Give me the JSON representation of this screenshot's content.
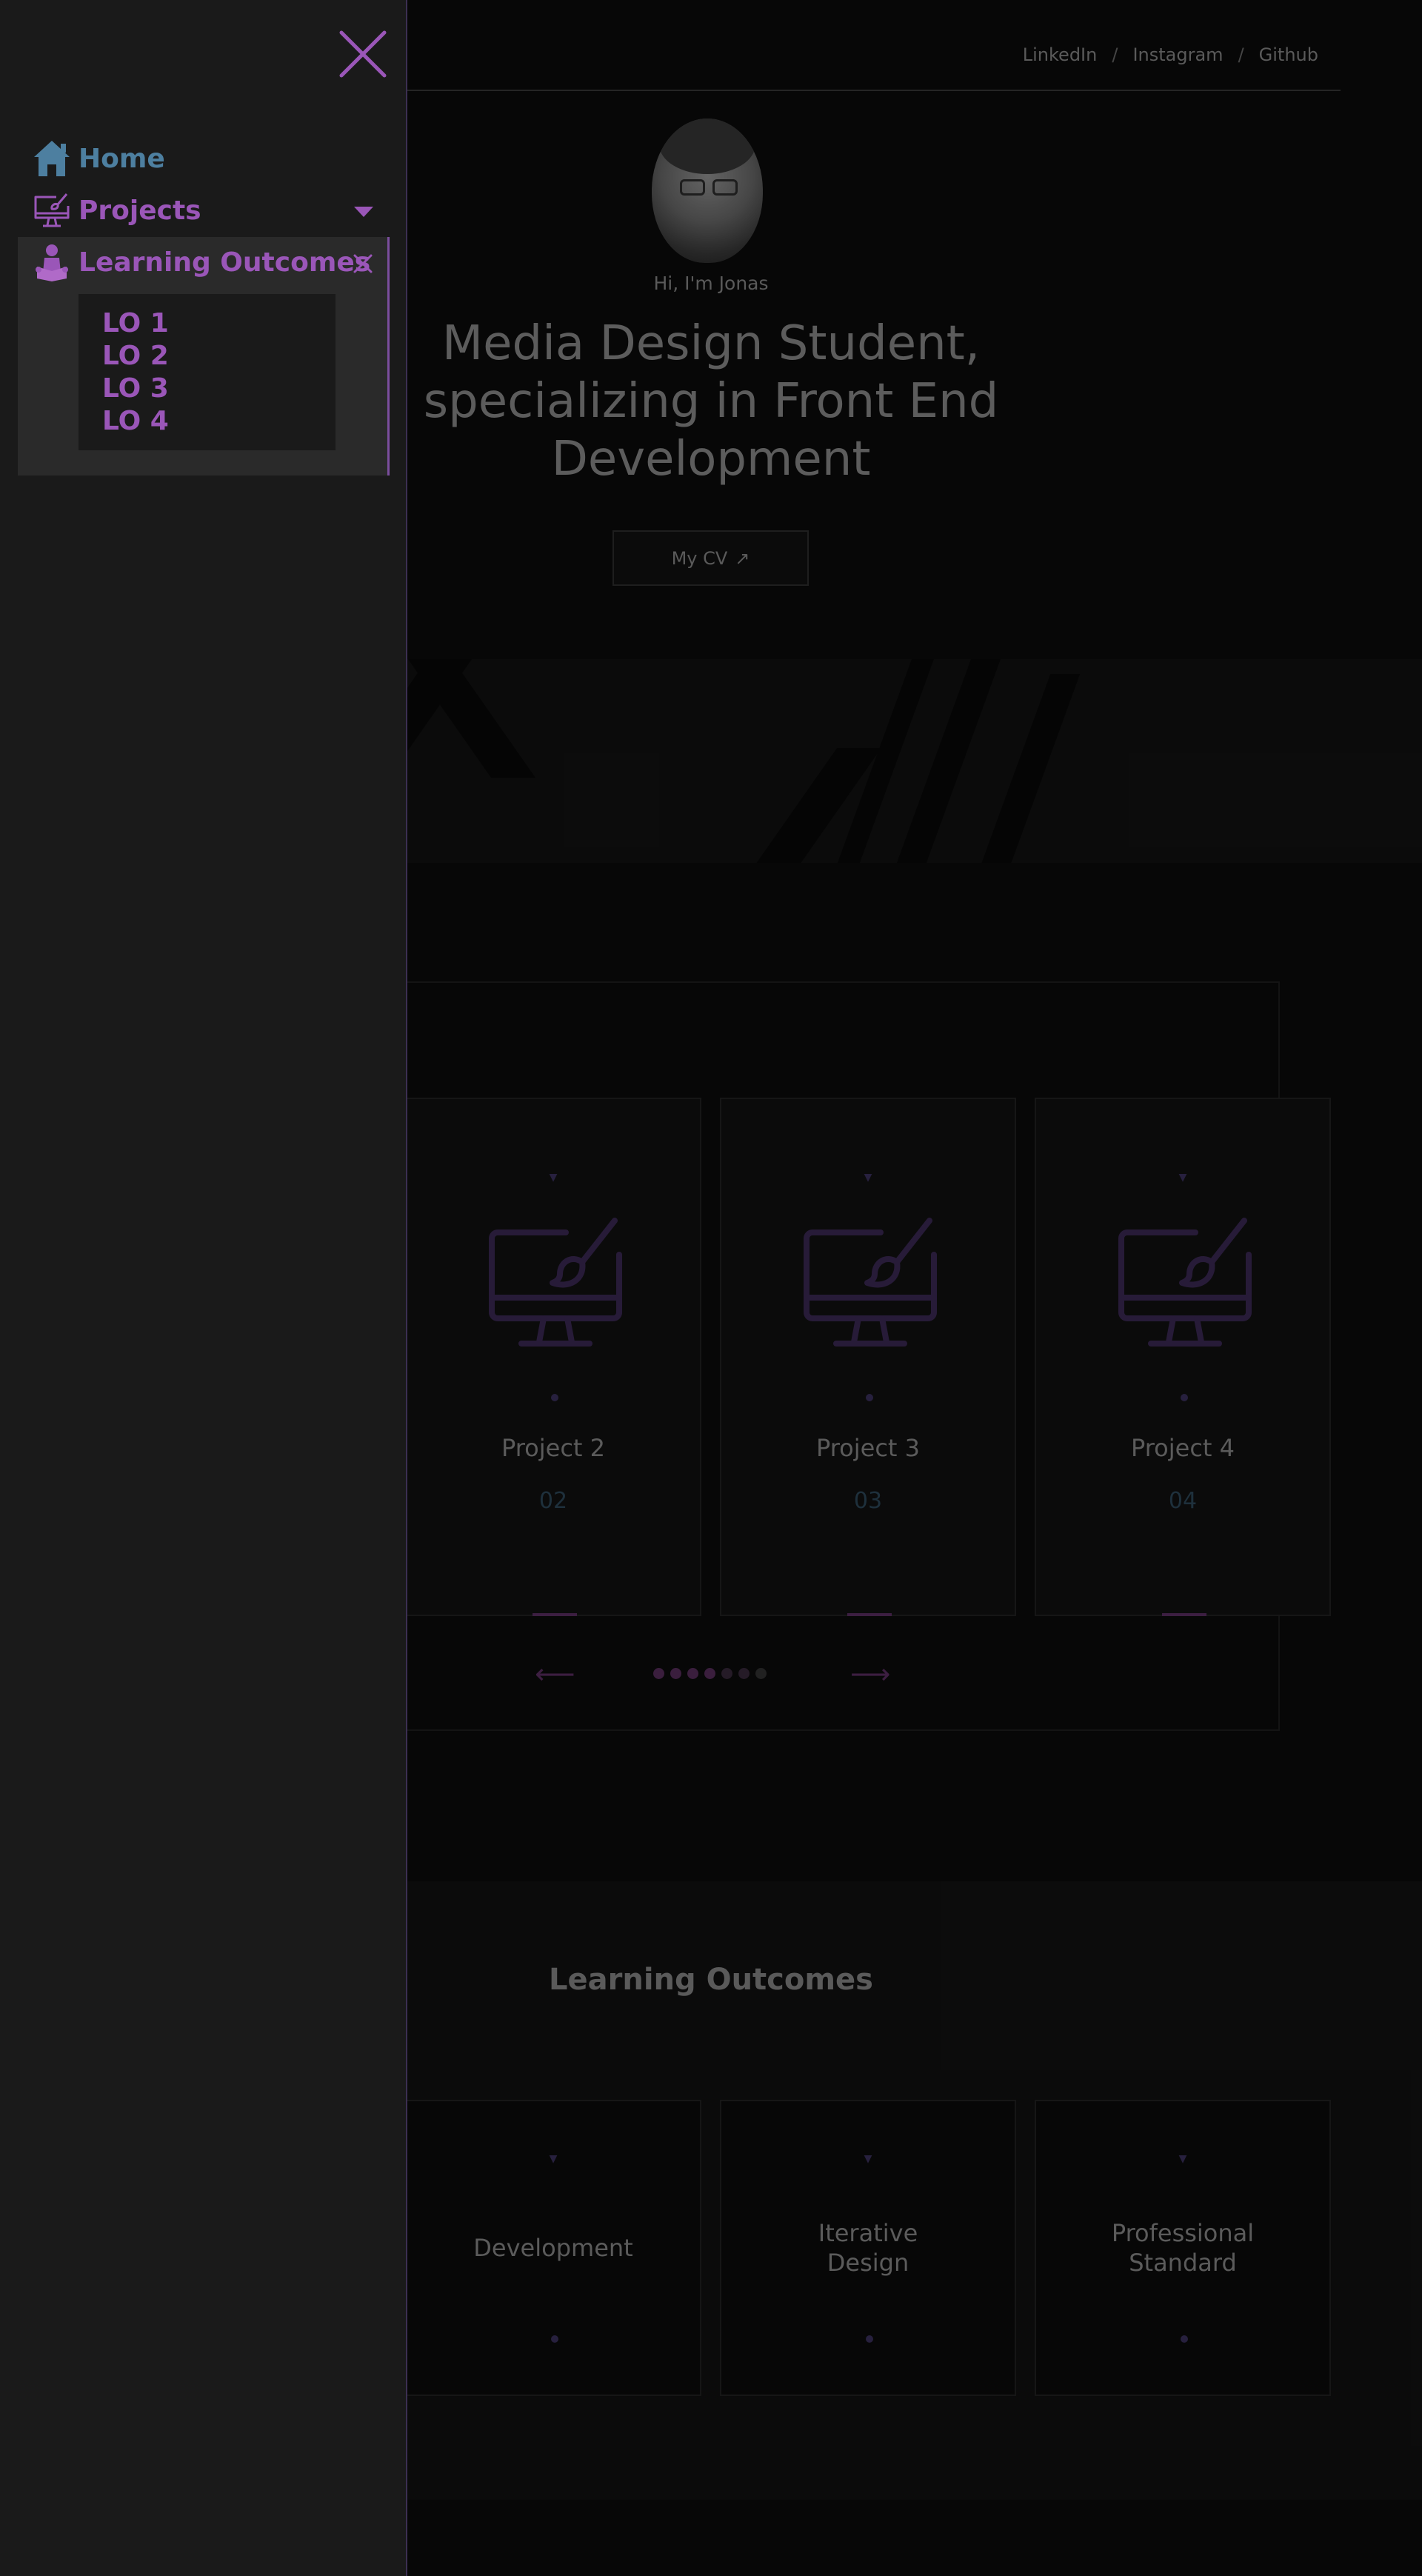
{
  "topnav": {
    "links": [
      "LinkedIn",
      "Instagram",
      "Github"
    ],
    "separator": "/"
  },
  "hero": {
    "greeting": "Hi, I'm Jonas",
    "headline": "Media Design Student, specializing in Front End Development",
    "cv_label": "My CV",
    "cv_icon": "external-link-arrow"
  },
  "projects": {
    "cards": [
      {
        "title": "Project 2",
        "number": "02"
      },
      {
        "title": "Project 3",
        "number": "03"
      },
      {
        "title": "Project 4",
        "number": "04"
      }
    ],
    "prev_label": "⟵",
    "next_label": "⟶",
    "dots_total": 7,
    "dots_active": 4
  },
  "learning_outcomes": {
    "heading": "Learning Outcomes",
    "cards": [
      {
        "title": "Development"
      },
      {
        "title": "Iterative\nDesign"
      },
      {
        "title": "Professional\nStandard"
      }
    ]
  },
  "drawer": {
    "items": [
      {
        "label": "Home",
        "icon": "home-icon"
      },
      {
        "label": "Projects",
        "icon": "monitor-brush-icon"
      },
      {
        "label": "Learning Outcomes",
        "icon": "reader-icon"
      }
    ],
    "sub_items": [
      "LO 1",
      "LO 2",
      "LO 3",
      "LO 4"
    ],
    "colors": {
      "home": "#4d7fa0",
      "accent": "#9a56b8",
      "panel": "#2a2a2a"
    }
  }
}
